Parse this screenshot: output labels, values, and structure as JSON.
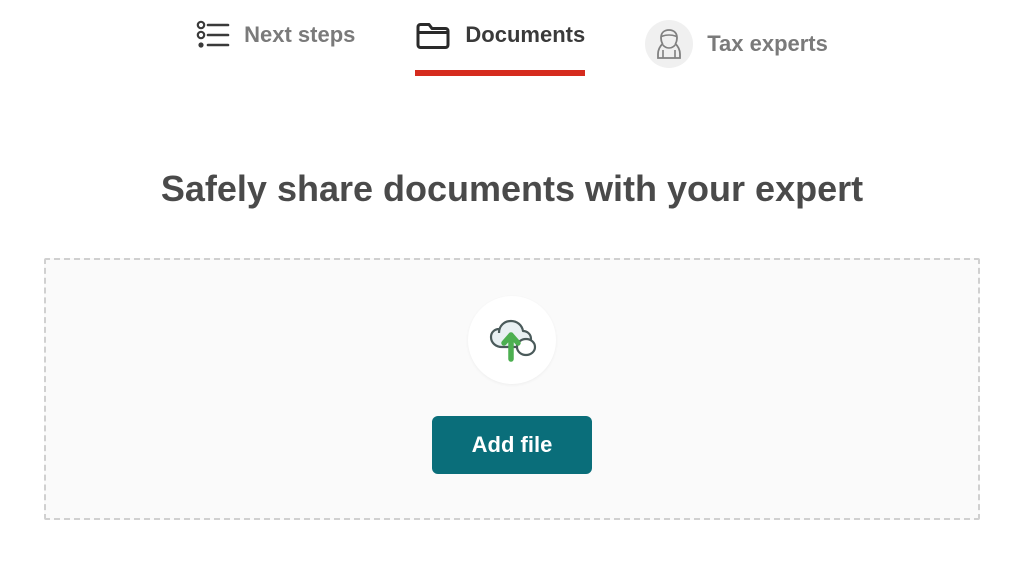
{
  "tabs": [
    {
      "label": "Next steps",
      "active": false
    },
    {
      "label": "Documents",
      "active": true
    },
    {
      "label": "Tax experts",
      "active": false
    }
  ],
  "main": {
    "title": "Safely share documents with your expert",
    "add_file_label": "Add file"
  }
}
